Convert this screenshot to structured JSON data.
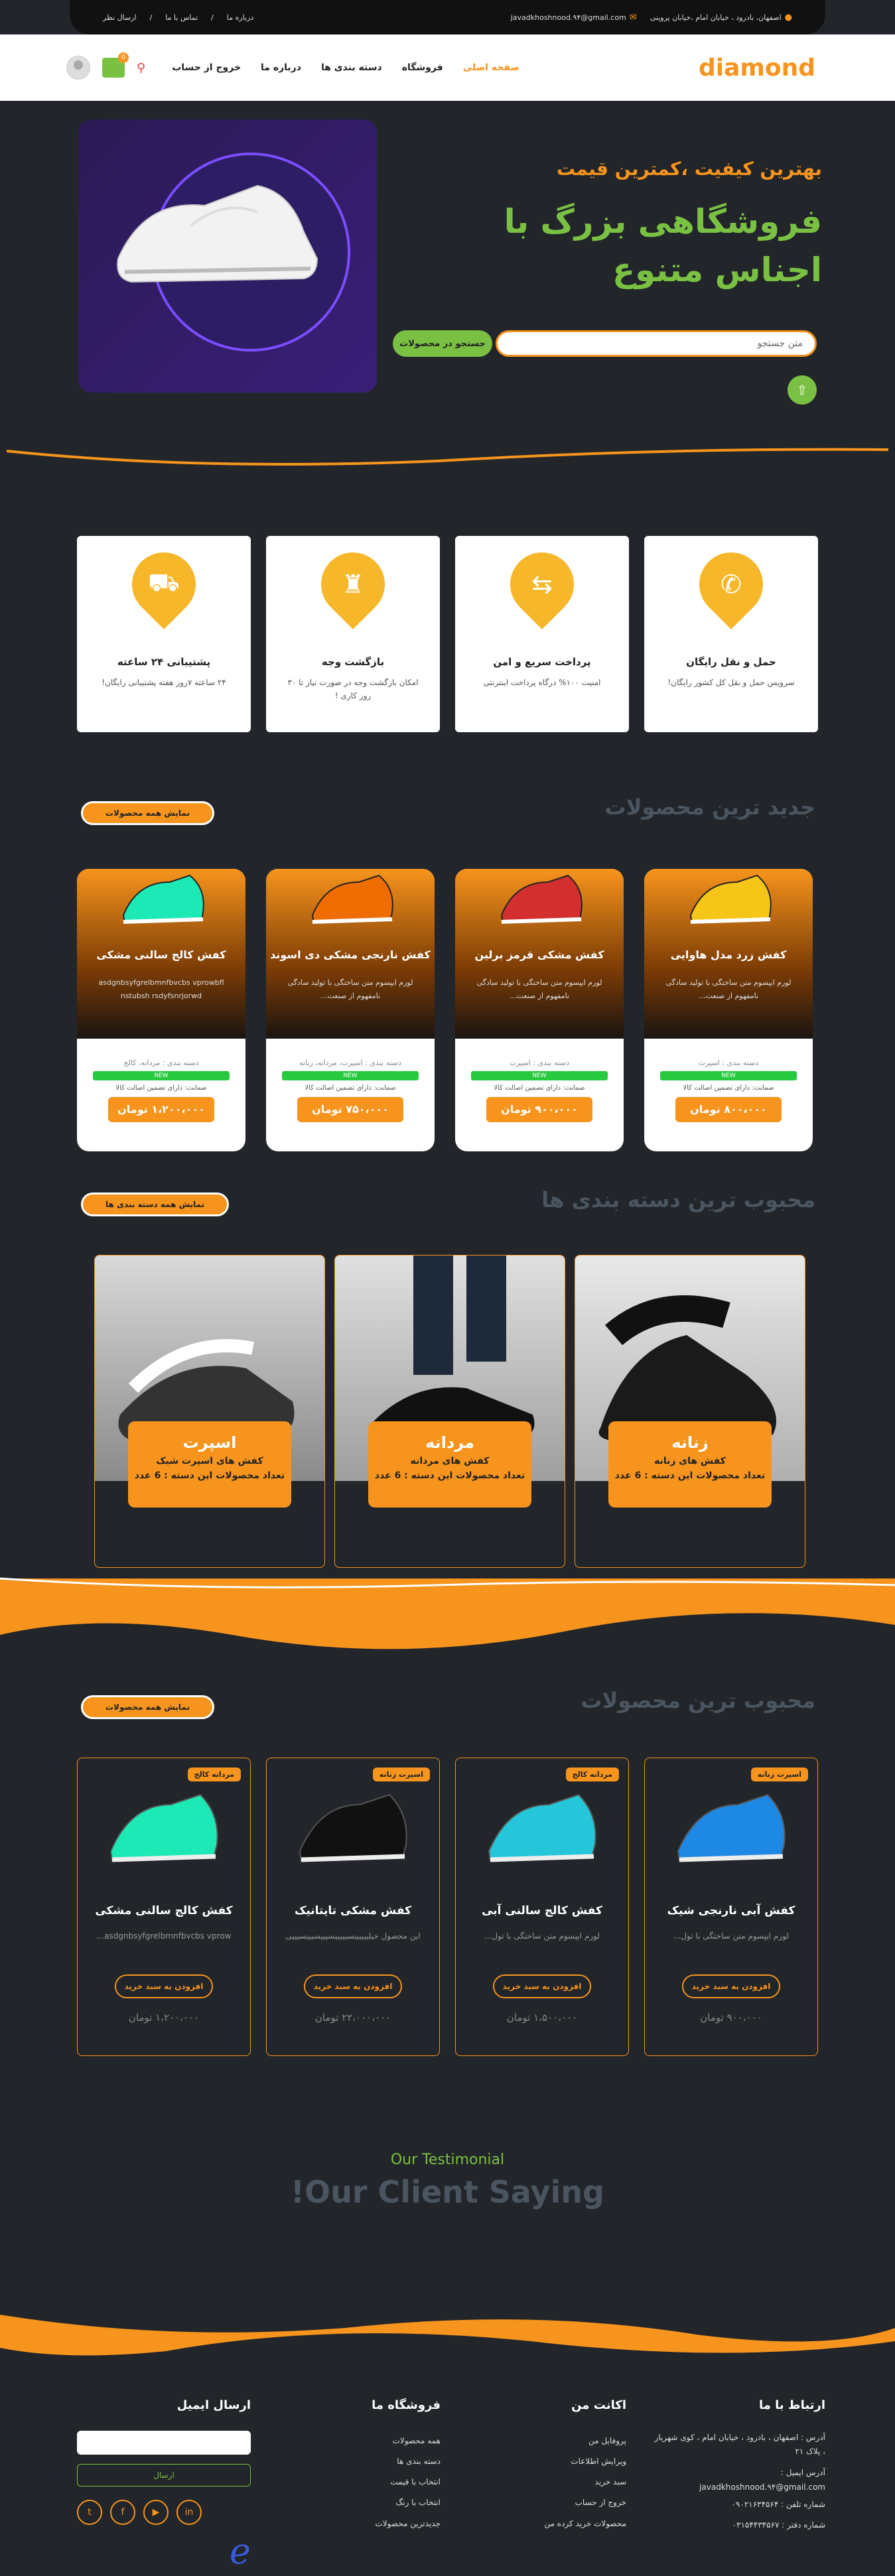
{
  "topbar": {
    "address": "اصفهان، بادرود ، خیابان امام ،خیابان پروینی",
    "email": "javadkhoshnood.۹۴@gmail.com",
    "links": [
      "درباره ما",
      "تماس با ما",
      "ارسال نظر"
    ]
  },
  "header": {
    "logo": "diamond",
    "nav": [
      "صفحه اصلی",
      "فروشگاه",
      "دسته بندی ها",
      "درباره ما",
      "خروج از حساب"
    ],
    "cart_count": "0"
  },
  "hero": {
    "subtitle": "بهترین کیفیت ،کمترین قیمت",
    "title": "فروشگاهی بزرگ با اجناس متنوع",
    "search_placeholder": "متن جستجو",
    "search_button": "جستجو در محصولات"
  },
  "features": [
    {
      "icon": "phone-icon",
      "title": "حمل و نقل رایگان",
      "text": "سرویس حمل و نقل کل کشور رایگان!"
    },
    {
      "icon": "transfer-icon",
      "title": "پرداخت سریع و امن",
      "text": "امنیت ۱۰۰% درگاه پرداخت اینترنتی"
    },
    {
      "icon": "user-shield-icon",
      "title": "بازگشت وجه",
      "text": "امکان بازگشت وجه در صورت نیاز تا ۳۰ روز کاری !"
    },
    {
      "icon": "car-icon",
      "title": "پشتیبانی ۲۴ ساعته",
      "text": "۲۴ ساعته ۷روز هفته پشتیبانی رایگان!"
    }
  ],
  "new_products": {
    "title": "جدید ترین محصولات",
    "more": "نمایش همه محصولات",
    "items": [
      {
        "name": "کفش زرد مدل هاوایی",
        "desc": "لورم ایپسوم متن ساختگی با تولید سادگی نامفهوم از صنعت...",
        "cat": "دسته بندی : اسپرت",
        "bar": "NEW",
        "warranty": "ضمانت: دارای تضمین اصالت کالا",
        "price": "۸۰۰،۰۰۰ تومان",
        "color": "#f5c518"
      },
      {
        "name": "کفش مشکی قرمز برلین",
        "desc": "لورم ایپسوم متن ساختگی با تولید سادگی نامفهوم از صنعت...",
        "cat": "دسته بندی : اسپرت",
        "bar": "NEW",
        "warranty": "ضمانت: دارای تضمین اصالت کالا",
        "price": "۹۰۰،۰۰۰ تومان",
        "color": "#d32f2f"
      },
      {
        "name": "کفش نارنجی مشکی دی اسوند",
        "desc": "لورم ایپسوم متن ساختگی با تولید سادگی نامفهوم از صنعت...",
        "cat": "دسته بندی : اسپرت، مردانه، زنانه",
        "bar": "NEW",
        "warranty": "ضمانت: دارای تضمین اصالت کالا",
        "price": "۷۵۰،۰۰۰ تومان",
        "color": "#ef6c00"
      },
      {
        "name": "کفش کالج سالنی مشکی",
        "desc": "asdgnbsyfgrelbmnfbvcbs vprowbfl nstubsh rsdyfsnrjorwd",
        "cat": "دسته بندی : مردانه، کالج",
        "bar": "NEW",
        "warranty": "ضمانت: دارای تضمین اصالت کالا",
        "price": "۱،۲۰۰،۰۰۰ تومان",
        "color": "#1de9b6"
      }
    ]
  },
  "categories": {
    "title": "محبوب ترین دسته بندی ها",
    "more": "نمایش همه دسته بندی ها",
    "items": [
      {
        "name": "زنانه",
        "sub": "کفش های زنانه",
        "count": "تعداد محصولات این دسته : 6 عدد"
      },
      {
        "name": "مردانه",
        "sub": "کفش های مردانه",
        "count": "تعداد محصولات این دسته : 6 عدد"
      },
      {
        "name": "اسپرت",
        "sub": "کفش های اسپرت شیک",
        "count": "تعداد محصولات این دسته : 6 عدد"
      }
    ]
  },
  "popular": {
    "title": "محبوب ترین محصولات",
    "more": "نمایش همه محصولات",
    "add_label": "افزودن به سبد خرید",
    "items": [
      {
        "tag": "اسپرت زنانه",
        "name": "کفش آبی نارنجی شیک",
        "desc": "لورم ایپسوم متن ساختگی با تول...",
        "price": "۹۰۰،۰۰۰ تومان",
        "color": "#1e88e5"
      },
      {
        "tag": "مردانه کالج",
        "name": "کفش کالج سالنی آبی",
        "desc": "لورم ایپسوم متن ساختگی با تول...",
        "price": "۱،۵۰۰،۰۰۰ تومان",
        "color": "#26c6da"
      },
      {
        "tag": "اسپرت زنانه",
        "name": "کفش مشکی تایتانیک",
        "desc": "این محصول خیلیییییبسیییییسیییسیییسیییی",
        "price": "۲۲،۰۰۰،۰۰۰ تومان",
        "color": "#111111"
      },
      {
        "tag": "مردانه کالج",
        "name": "کفش کالج سالنی مشکی",
        "desc": "asdgnbsyfgrelbmnfbvcbs vprow...",
        "price": "۱،۲۰۰،۰۰۰ تومان",
        "color": "#1de9b6"
      }
    ]
  },
  "testimonial": {
    "subtitle": "Our Testimonial",
    "title": "Our Client Saying!"
  },
  "footer": {
    "contact": {
      "title": "ارتباط با ما",
      "address": "آدرس : اصفهان ، بادرود ، خیابان امام ، کوی شهریار ، پلاک ۲۱",
      "email": "آدرس ایمیل : javadkhoshnood.۹۴@gmail.com",
      "phone": "شماره تلفن : ۰۹۰۲۱۶۳۴۵۶۴",
      "office": "شماره دفتر : ۰۳۱۵۴۴۳۴۵۶۷"
    },
    "account": {
      "title": "اکانت من",
      "links": [
        "پروفایل من",
        "ویرایش اطلاعات",
        "سبد خرید",
        "خروج از حساب",
        "محصولات خرید کرده من"
      ]
    },
    "shop": {
      "title": "فروشگاه ما",
      "links": [
        "همه محصولات",
        "دسته بندی ها",
        "انتخاب با قیمت",
        "انتخاب با رنگ",
        "جدیدترین محصولات"
      ]
    },
    "email": {
      "title": "ارسال ایمیل",
      "button": "ارسال"
    }
  }
}
